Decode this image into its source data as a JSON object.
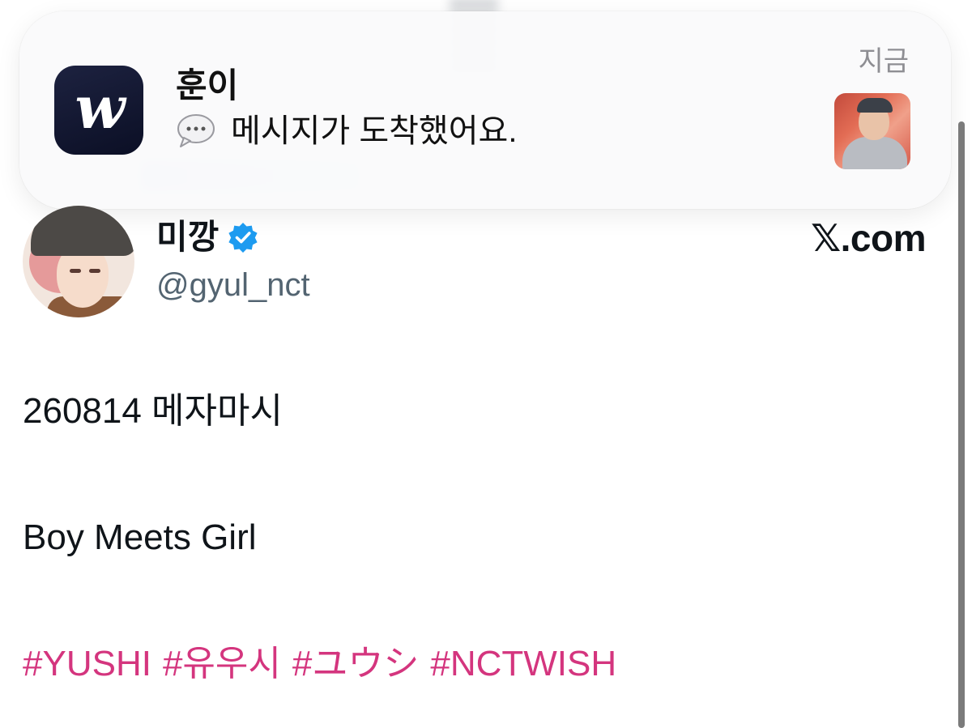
{
  "notification": {
    "app_icon_glyph": "w",
    "sender": "훈이",
    "message": "메시지가 도착했어요.",
    "time": "지금",
    "message_icon": "speech-bubble-icon"
  },
  "tweet": {
    "display_name": "미깡",
    "handle": "@gyul_nct",
    "source": "𝕏.com",
    "lines": [
      "260814 메자마시",
      "Boy Meets Girl"
    ],
    "hashtags": [
      "#YUSHI",
      "#유우시",
      "#ユウシ",
      "#NCTWISH"
    ]
  },
  "colors": {
    "hashtag": "#d4357e",
    "verified": "#1d9bf0",
    "handle": "#536471",
    "app_icon_bg": "#0b0f25"
  }
}
